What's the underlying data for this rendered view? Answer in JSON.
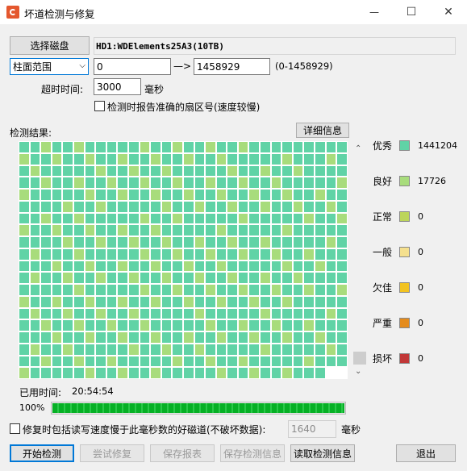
{
  "window": {
    "title": "坏道检测与修复",
    "help_label": "?",
    "minimize_label": "—",
    "maximize_label": "☐",
    "close_label": "✕"
  },
  "disk": {
    "select_button": "选择磁盘",
    "name": "HD1:WDElements25A3(10TB)"
  },
  "range": {
    "mode": "柱面范围",
    "start": "0",
    "arrow": "—>",
    "end": "1458929",
    "hint": "(0-1458929)"
  },
  "timeout": {
    "label": "超时时间:",
    "value": "3000",
    "unit": "毫秒"
  },
  "options": {
    "report_sector_label": "检测时报告准确的扇区号(速度较慢)",
    "report_sector_checked": false,
    "repair_label": "修复时包括读写速度慢于此毫秒数的好磁道(不破坏数据):",
    "repair_checked": false,
    "repair_value": "1640",
    "repair_unit": "毫秒"
  },
  "results": {
    "label": "检测结果:",
    "detail_button": "详细信息"
  },
  "grid": {
    "columns": 30,
    "rows": 20,
    "last_row_cells": 28,
    "excellent_color": "#60d3a6",
    "good_color": "#a8dc7c",
    "good_cells": [
      [
        0,
        2
      ],
      [
        0,
        5
      ],
      [
        0,
        11
      ],
      [
        0,
        14
      ],
      [
        0,
        17
      ],
      [
        0,
        20
      ],
      [
        1,
        0
      ],
      [
        1,
        3
      ],
      [
        1,
        6
      ],
      [
        1,
        9
      ],
      [
        1,
        12
      ],
      [
        1,
        15
      ],
      [
        1,
        18
      ],
      [
        1,
        24
      ],
      [
        1,
        28
      ],
      [
        2,
        1
      ],
      [
        2,
        7
      ],
      [
        2,
        10
      ],
      [
        2,
        13
      ],
      [
        2,
        19
      ],
      [
        2,
        22
      ],
      [
        2,
        25
      ],
      [
        3,
        2
      ],
      [
        3,
        5
      ],
      [
        3,
        8
      ],
      [
        3,
        11
      ],
      [
        3,
        14
      ],
      [
        3,
        17
      ],
      [
        3,
        20
      ],
      [
        3,
        23
      ],
      [
        3,
        29
      ],
      [
        4,
        0
      ],
      [
        4,
        6
      ],
      [
        4,
        9
      ],
      [
        4,
        12
      ],
      [
        4,
        15
      ],
      [
        4,
        18
      ],
      [
        4,
        21
      ],
      [
        4,
        24
      ],
      [
        4,
        27
      ],
      [
        5,
        4
      ],
      [
        5,
        7
      ],
      [
        5,
        13
      ],
      [
        5,
        16
      ],
      [
        5,
        19
      ],
      [
        5,
        22
      ],
      [
        5,
        25
      ],
      [
        5,
        28
      ],
      [
        6,
        2
      ],
      [
        6,
        5
      ],
      [
        6,
        11
      ],
      [
        6,
        14
      ],
      [
        6,
        20
      ],
      [
        6,
        26
      ],
      [
        6,
        29
      ],
      [
        7,
        0
      ],
      [
        7,
        3
      ],
      [
        7,
        6
      ],
      [
        7,
        9
      ],
      [
        7,
        12
      ],
      [
        7,
        18
      ],
      [
        7,
        24
      ],
      [
        8,
        4
      ],
      [
        8,
        7
      ],
      [
        8,
        10
      ],
      [
        8,
        13
      ],
      [
        8,
        16
      ],
      [
        8,
        19
      ],
      [
        8,
        22
      ],
      [
        8,
        28
      ],
      [
        9,
        1
      ],
      [
        9,
        5
      ],
      [
        9,
        11
      ],
      [
        9,
        14
      ],
      [
        9,
        17
      ],
      [
        9,
        20
      ],
      [
        9,
        23
      ],
      [
        9,
        26
      ],
      [
        10,
        3
      ],
      [
        10,
        6
      ],
      [
        10,
        9
      ],
      [
        10,
        12
      ],
      [
        10,
        15
      ],
      [
        10,
        18
      ],
      [
        10,
        24
      ],
      [
        10,
        27
      ],
      [
        11,
        1
      ],
      [
        11,
        4
      ],
      [
        11,
        7
      ],
      [
        11,
        10
      ],
      [
        11,
        13
      ],
      [
        11,
        16
      ],
      [
        11,
        19
      ],
      [
        11,
        22
      ],
      [
        11,
        25
      ],
      [
        12,
        5
      ],
      [
        12,
        11
      ],
      [
        12,
        14
      ],
      [
        12,
        17
      ],
      [
        12,
        20
      ],
      [
        12,
        23
      ],
      [
        12,
        26
      ],
      [
        12,
        29
      ],
      [
        13,
        0
      ],
      [
        13,
        3
      ],
      [
        13,
        6
      ],
      [
        13,
        9
      ],
      [
        13,
        12
      ],
      [
        13,
        15
      ],
      [
        13,
        18
      ],
      [
        13,
        21
      ],
      [
        13,
        24
      ],
      [
        14,
        1
      ],
      [
        14,
        4
      ],
      [
        14,
        7
      ],
      [
        14,
        10
      ],
      [
        14,
        16
      ],
      [
        14,
        22
      ],
      [
        14,
        28
      ],
      [
        15,
        2
      ],
      [
        15,
        5
      ],
      [
        15,
        8
      ],
      [
        15,
        11
      ],
      [
        15,
        17
      ],
      [
        15,
        20
      ],
      [
        15,
        23
      ],
      [
        15,
        26
      ],
      [
        16,
        3
      ],
      [
        16,
        6
      ],
      [
        16,
        9
      ],
      [
        16,
        12
      ],
      [
        16,
        15
      ],
      [
        16,
        18
      ],
      [
        16,
        21
      ],
      [
        16,
        24
      ],
      [
        16,
        27
      ],
      [
        17,
        1
      ],
      [
        17,
        4
      ],
      [
        17,
        10
      ],
      [
        17,
        13
      ],
      [
        17,
        16
      ],
      [
        17,
        22
      ],
      [
        17,
        28
      ],
      [
        18,
        2
      ],
      [
        18,
        5
      ],
      [
        18,
        8
      ],
      [
        18,
        14
      ],
      [
        18,
        17
      ],
      [
        18,
        20
      ],
      [
        18,
        26
      ],
      [
        19,
        0
      ],
      [
        19,
        6
      ],
      [
        19,
        9
      ],
      [
        19,
        12
      ],
      [
        19,
        18
      ],
      [
        19,
        21
      ],
      [
        19,
        24
      ]
    ]
  },
  "scroll": {
    "up": "⌃",
    "down": "⌄"
  },
  "legend": [
    {
      "label": "优秀",
      "count": "1441204",
      "color": "#60d3a6"
    },
    {
      "label": "良好",
      "count": "17726",
      "color": "#a8dc7c"
    },
    {
      "label": "正常",
      "count": "0",
      "color": "#bcd55a"
    },
    {
      "label": "一般",
      "count": "0",
      "color": "#f5e08e"
    },
    {
      "label": "欠佳",
      "count": "0",
      "color": "#f2c321"
    },
    {
      "label": "严重",
      "count": "0",
      "color": "#e48b1c"
    },
    {
      "label": "损坏",
      "count": "0",
      "color": "#c13838"
    }
  ],
  "status": {
    "elapsed_label": "已用时间:",
    "elapsed_value": "20:54:54",
    "percent_text": "100%",
    "progress": 1.0
  },
  "buttons": {
    "start": "开始检测",
    "try_repair": "尝试修复",
    "save_report": "保存报表",
    "save_info": "保存检测信息",
    "load_info": "读取检测信息",
    "exit": "退出"
  }
}
